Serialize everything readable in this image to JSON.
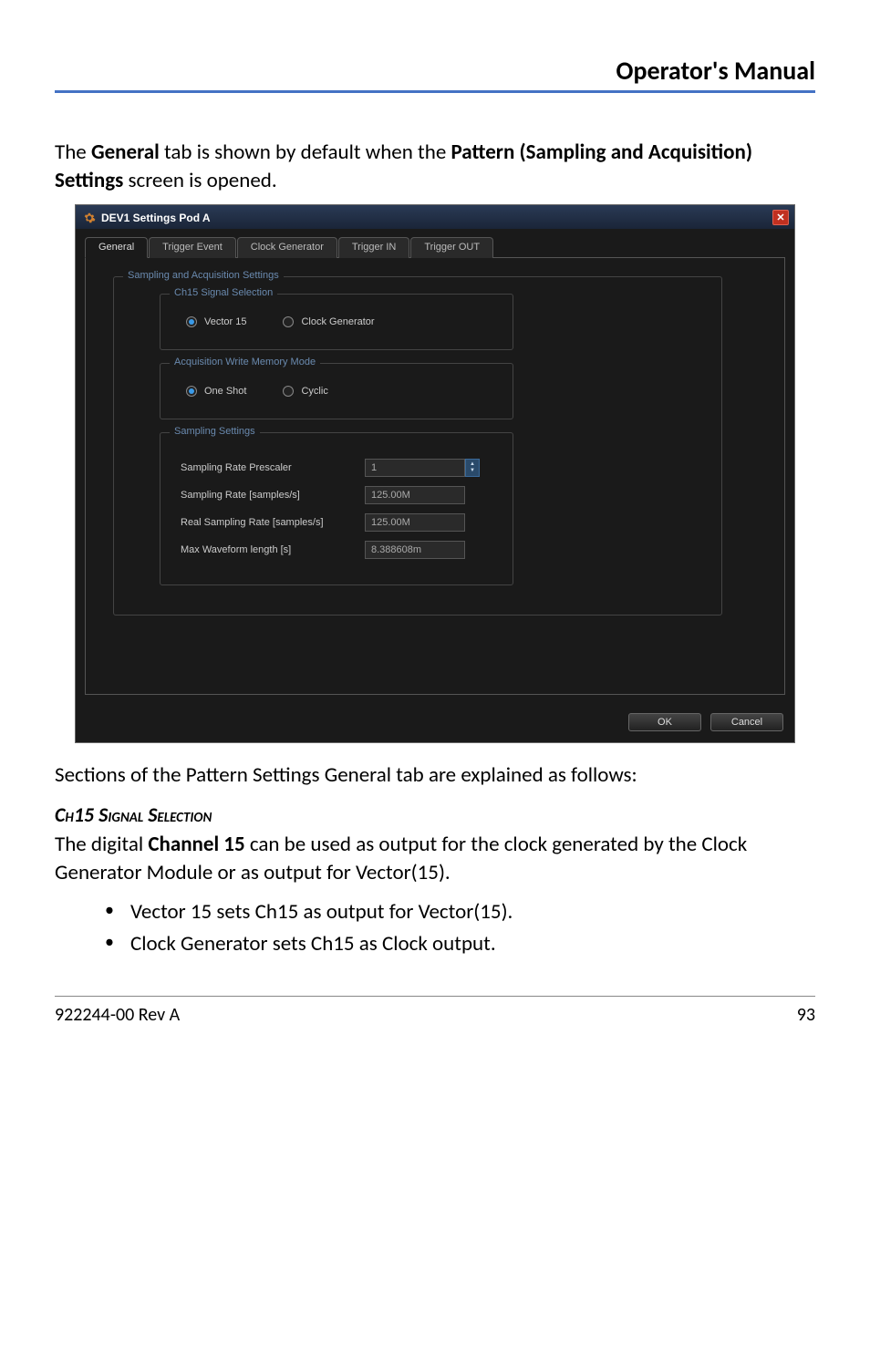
{
  "header": {
    "title": "Operator's Manual"
  },
  "para1_a": "The ",
  "para1_b": "General",
  "para1_c": " tab is shown by default when the ",
  "para1_d": "Pattern (Sampling and Acquisition) Settings",
  "para1_e": " screen is opened.",
  "dialog": {
    "title": "DEV1 Settings Pod A",
    "tabs": {
      "general": "General",
      "trigger_event": "Trigger Event",
      "clock_generator": "Clock Generator",
      "trigger_in": "Trigger IN",
      "trigger_out": "Trigger OUT"
    },
    "group_sampling": "Sampling and Acquisition Settings",
    "group_ch15": "Ch15 Signal Selection",
    "radio_vector15": "Vector 15",
    "radio_clockgen": "Clock Generator",
    "group_acq": "Acquisition Write Memory Mode",
    "radio_oneshot": "One Shot",
    "radio_cyclic": "Cyclic",
    "group_sampset": "Sampling Settings",
    "field_prescaler_label": "Sampling Rate Prescaler",
    "field_prescaler_value": "1",
    "field_rate_label": "Sampling Rate [samples/s]",
    "field_rate_value": "125.00M",
    "field_realrate_label": "Real Sampling Rate [samples/s]",
    "field_realrate_value": "125.00M",
    "field_maxwave_label": "Max Waveform length [s]",
    "field_maxwave_value": "8.388608m",
    "btn_ok": "OK",
    "btn_cancel": "Cancel"
  },
  "para2": "Sections of the Pattern Settings General tab are explained as follows:",
  "sec_heading": "Ch15 Signal Selection",
  "para3_a": "The digital ",
  "para3_b": "Channel 15",
  "para3_c": " can be used as output for the clock generated by the Clock Generator Module or as output for Vector(15).",
  "bullet1": "Vector 15 sets Ch15 as output for Vector(15).",
  "bullet2": "Clock Generator sets Ch15 as Clock output.",
  "footer": {
    "left": "922244-00 Rev A",
    "right": "93"
  }
}
